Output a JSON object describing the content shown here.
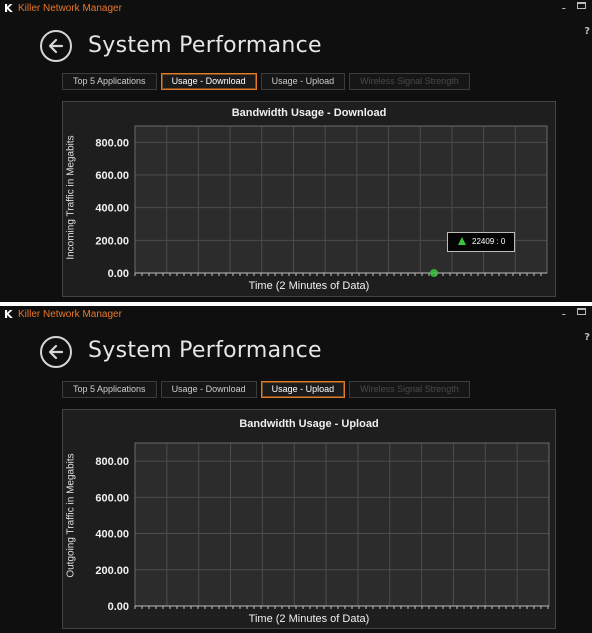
{
  "window": {
    "logo": "K",
    "title": "Killer Network Manager",
    "minimize": "-",
    "help": "?"
  },
  "page_title": "System Performance",
  "tabs": [
    {
      "label": "Top 5 Applications",
      "state": "normal"
    },
    {
      "label": "Usage - Download",
      "state": "normal"
    },
    {
      "label": "Usage - Upload",
      "state": "normal"
    },
    {
      "label": "Wireless Signal Strength",
      "state": "disabled"
    }
  ],
  "download_panel": {
    "active_tab": "Usage - Download",
    "tooltip": "22409 : 0"
  },
  "upload_panel": {
    "active_tab": "Usage - Upload"
  },
  "colors": {
    "accent": "#e07b28",
    "background": "#0f0f0f",
    "plot_background": "#2c2c2c",
    "gridline": "#4d4d4d",
    "data_point": "#3cc43c"
  },
  "chart_data": [
    {
      "type": "line",
      "title": "Bandwidth Usage - Download",
      "xlabel": "Time (2 Minutes of Data)",
      "ylabel": "Incoming Traffic in Megabits",
      "ylim": [
        0,
        900
      ],
      "yticks": [
        "0.00",
        "200.00",
        "400.00",
        "600.00",
        "800.00"
      ],
      "grid": true,
      "series": [
        {
          "values": [
            {
              "x": 22409,
              "y": 0
            }
          ]
        }
      ]
    },
    {
      "type": "line",
      "title": "Bandwidth Usage - Upload",
      "xlabel": "Time (2 Minutes of Data)",
      "ylabel": "Outgoing Traffic in Megabits",
      "ylim": [
        0,
        900
      ],
      "yticks": [
        "0.00",
        "200.00",
        "400.00",
        "600.00",
        "800.00"
      ],
      "grid": true,
      "series": []
    }
  ]
}
